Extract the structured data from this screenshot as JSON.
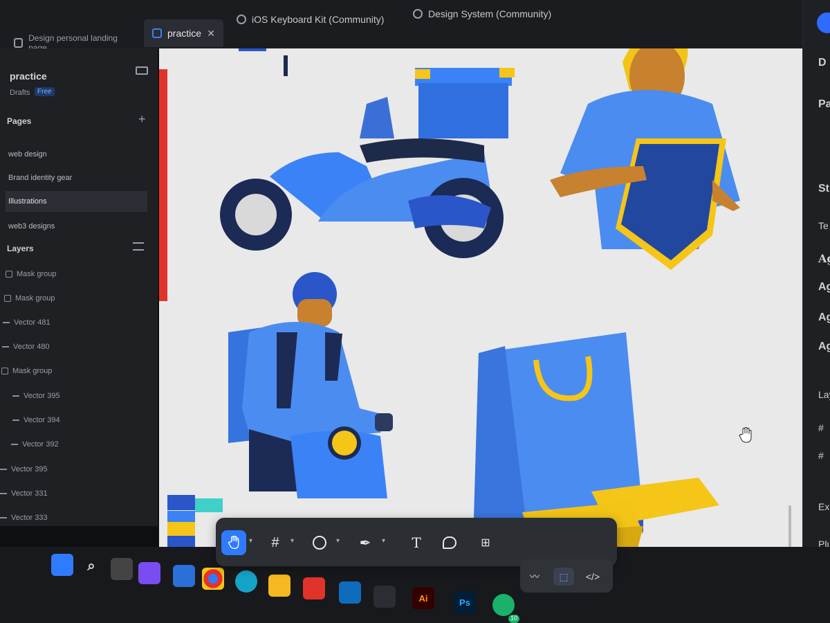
{
  "tabs": {
    "landing": "Design personal landing page",
    "practice": "practice",
    "keyboard": "iOS Keyboard Kit (Community)",
    "design_system": "Design System (Community)",
    "close": "✕"
  },
  "sidebar": {
    "file_name": "practice",
    "drafts": "Drafts",
    "badge": "Free",
    "pages_label": "Pages",
    "add": "+",
    "pages": [
      "web design",
      "Brand identity gear",
      "Illustrations",
      "web3 designs"
    ],
    "layers_label": "Layers",
    "layers": [
      "Mask group",
      "Mask group",
      "Vector 481",
      "Vector 480",
      "Mask group",
      "Vector 395",
      "Vector 394",
      "Vector 392",
      "Vector 395",
      "Vector 331",
      "Vector 333"
    ]
  },
  "right_panel": {
    "labels": [
      "D",
      "Pa",
      "St",
      "Te",
      "Ag",
      "Ag",
      "Ag",
      "Ag",
      "Lay",
      "Exp",
      "Plug"
    ]
  },
  "toolbar": {
    "text_tool": "T",
    "code": "</>"
  },
  "taskbar": {
    "illustrator": "Ai",
    "photoshop": "Ps",
    "whatsapp_count": "10"
  },
  "colors": {
    "canvas": "#e9e9ea",
    "accent_blue": "#2f7bff",
    "illustration_blue": "#3b82f6",
    "illustration_dark": "#1e3a8a",
    "illustration_yellow": "#f5c518",
    "red_frame": "#e2332a"
  },
  "icons": [
    "figma-icon",
    "close-icon",
    "plus-icon",
    "panel-icon",
    "hand-icon",
    "frame-icon",
    "ellipse-icon",
    "pen-icon",
    "text-icon",
    "comment-icon",
    "plugins-icon",
    "draw-icon",
    "devmode-icon",
    "code-icon",
    "windows-icon",
    "search-icon",
    "chrome-icon",
    "edge-icon",
    "explorer-icon",
    "store-icon"
  ]
}
